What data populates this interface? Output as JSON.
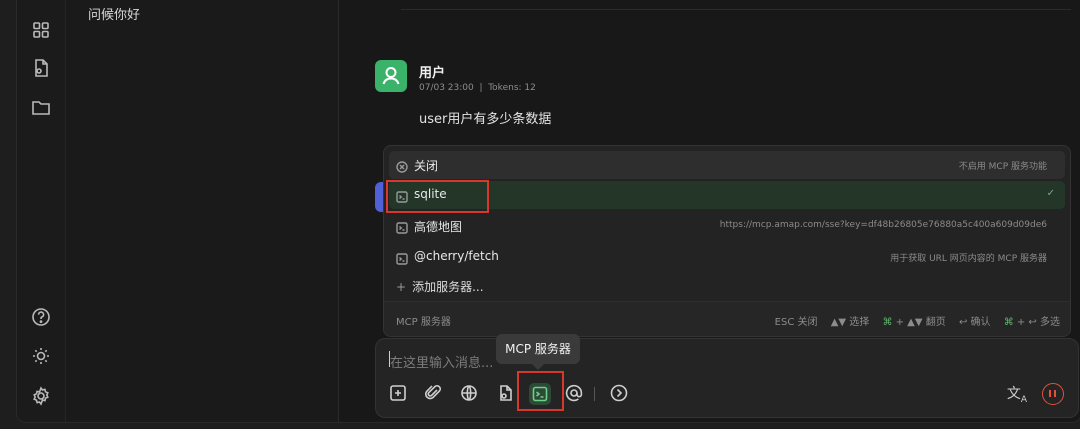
{
  "sidebar": {
    "icons": [
      "apps-icon",
      "file-icon",
      "folder-icon",
      "help-icon",
      "theme-icon",
      "settings-icon"
    ]
  },
  "topics": {
    "items": [
      {
        "label": "问候你好"
      }
    ]
  },
  "message": {
    "author": "用户",
    "meta": "07/03 23:00  |  Tokens: 12",
    "text": "user用户有多少条数据"
  },
  "mcp_popup": {
    "options": [
      {
        "label": "关闭",
        "desc": "不启用 MCP 服务功能"
      },
      {
        "label": "sqlite",
        "desc": ""
      },
      {
        "label": "高德地图",
        "desc": "https://mcp.amap.com/sse?key=df48b26805e76880a5c400a609d09de6"
      },
      {
        "label": "@cherry/fetch",
        "desc": "用于获取 URL 网页内容的 MCP 服务器"
      }
    ],
    "add_label": "添加服务器...",
    "footer_title": "MCP 服务器",
    "hints": {
      "esc": "ESC 关闭",
      "select": "▲▼ 选择",
      "page_key": "⌘",
      "page": "+ ▲▼ 翻页",
      "confirm": "↩ 确认",
      "multi_key": "⌘",
      "multi": "+ ↩ 多选"
    }
  },
  "input": {
    "placeholder": "在这里输入消息..."
  },
  "tooltip": "MCP 服务器",
  "colors": {
    "accent": "#3bb26a",
    "highlight_red": "#d9372b",
    "pause": "#e0523b"
  }
}
